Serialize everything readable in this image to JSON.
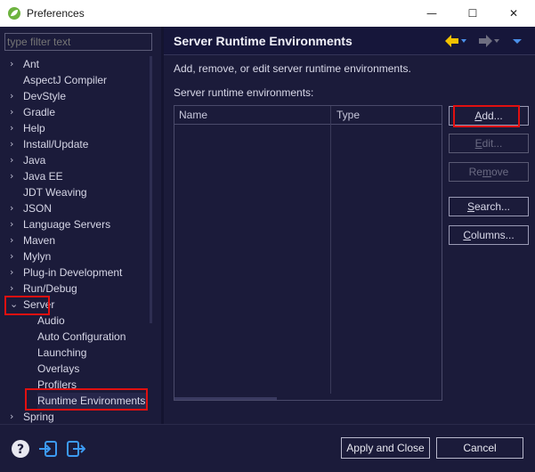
{
  "window": {
    "title": "Preferences",
    "minimize_glyph": "—",
    "maximize_glyph": "☐",
    "close_glyph": "✕"
  },
  "filter": {
    "placeholder": "type filter text",
    "value": ""
  },
  "tree": {
    "items": [
      {
        "label": "Ant",
        "expandable": true,
        "level": 0
      },
      {
        "label": "AspectJ Compiler",
        "expandable": false,
        "level": 0
      },
      {
        "label": "DevStyle",
        "expandable": true,
        "level": 0
      },
      {
        "label": "Gradle",
        "expandable": true,
        "level": 0
      },
      {
        "label": "Help",
        "expandable": true,
        "level": 0
      },
      {
        "label": "Install/Update",
        "expandable": true,
        "level": 0
      },
      {
        "label": "Java",
        "expandable": true,
        "level": 0
      },
      {
        "label": "Java EE",
        "expandable": true,
        "level": 0
      },
      {
        "label": "JDT Weaving",
        "expandable": false,
        "level": 0
      },
      {
        "label": "JSON",
        "expandable": true,
        "level": 0
      },
      {
        "label": "Language Servers",
        "expandable": true,
        "level": 0
      },
      {
        "label": "Maven",
        "expandable": true,
        "level": 0
      },
      {
        "label": "Mylyn",
        "expandable": true,
        "level": 0
      },
      {
        "label": "Plug-in Development",
        "expandable": true,
        "level": 0
      },
      {
        "label": "Run/Debug",
        "expandable": true,
        "level": 0
      },
      {
        "label": "Server",
        "expandable": true,
        "expanded": true,
        "level": 0
      },
      {
        "label": "Audio",
        "expandable": false,
        "level": 1
      },
      {
        "label": "Auto Configuration",
        "expandable": false,
        "level": 1
      },
      {
        "label": "Launching",
        "expandable": false,
        "level": 1
      },
      {
        "label": "Overlays",
        "expandable": false,
        "level": 1
      },
      {
        "label": "Profilers",
        "expandable": false,
        "level": 1
      },
      {
        "label": "Runtime Environments",
        "expandable": false,
        "level": 1,
        "selected": true
      },
      {
        "label": "Spring",
        "expandable": true,
        "level": 0
      }
    ]
  },
  "page": {
    "title": "Server Runtime Environments",
    "description": "Add, remove, or edit server runtime environments.",
    "list_label": "Server runtime environments:",
    "table": {
      "columns": [
        "Name",
        "Type"
      ],
      "rows": []
    },
    "buttons": {
      "add": {
        "pre": "",
        "mnemonic": "A",
        "post": "dd...",
        "enabled": true
      },
      "edit": {
        "pre": "",
        "mnemonic": "E",
        "post": "dit...",
        "enabled": false
      },
      "remove": {
        "pre": "Re",
        "mnemonic": "m",
        "post": "ove",
        "enabled": false
      },
      "search": {
        "pre": "",
        "mnemonic": "S",
        "post": "earch...",
        "enabled": true
      },
      "columns": {
        "pre": "",
        "mnemonic": "C",
        "post": "olumns...",
        "enabled": true
      }
    }
  },
  "footer": {
    "apply_close_label": "Apply and Close",
    "cancel_label": "Cancel"
  },
  "colors": {
    "background": "#1b1b3a",
    "highlight": "#e01010",
    "nav_back": "#f2c200",
    "nav_accent": "#4a8fe8",
    "footer_icon": "#3c9af2"
  },
  "icons": [
    "spring-leaf-icon",
    "help-icon",
    "import-icon",
    "export-icon",
    "back-arrow-icon",
    "forward-arrow-icon",
    "view-menu-icon"
  ]
}
